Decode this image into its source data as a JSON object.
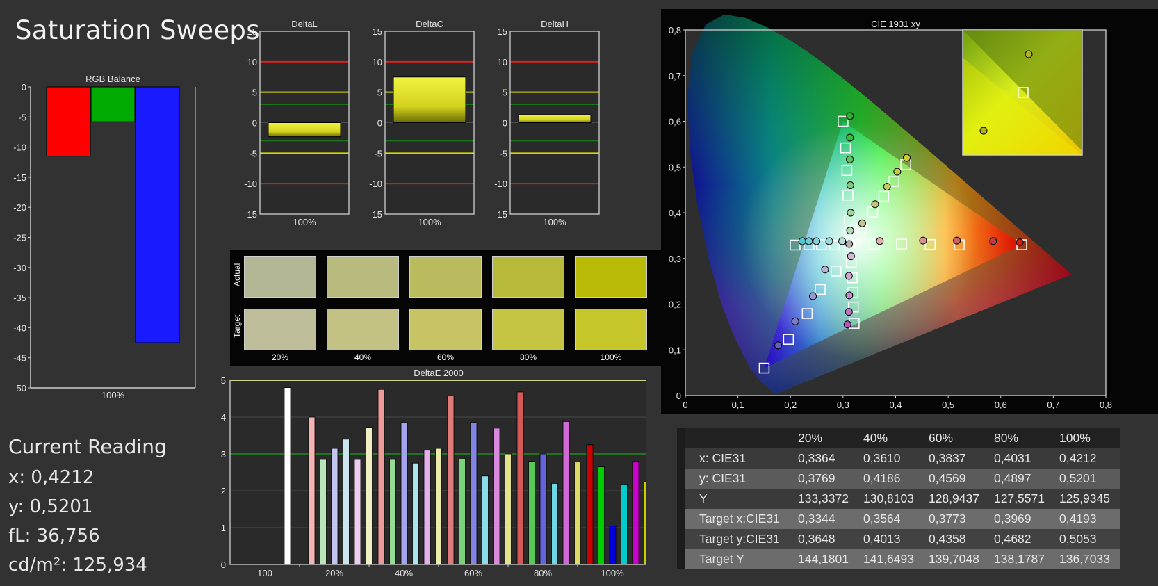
{
  "page": {
    "title": "Saturation Sweeps"
  },
  "current_reading": {
    "heading": "Current Reading",
    "x": "x: 0,4212",
    "y": "y: 0,5201",
    "fl": "fL: 36,756",
    "cdm2": "cd/m²: 125,934"
  },
  "swatches": {
    "row_labels": [
      "Actual",
      "Target"
    ],
    "columns": [
      "20%",
      "40%",
      "60%",
      "80%",
      "100%"
    ],
    "actual_colors": [
      "#b3b794",
      "#b8ba7e",
      "#b9bb5e",
      "#b6b93a",
      "#b9ba05"
    ],
    "target_colors": [
      "#bfbe9b",
      "#c3c183",
      "#c6c464",
      "#c5c443",
      "#c6c529"
    ]
  },
  "table": {
    "headers": [
      "",
      "20%",
      "40%",
      "60%",
      "80%",
      "100%"
    ],
    "rows": [
      {
        "label": "x: CIE31",
        "values": [
          "0,3364",
          "0,3610",
          "0,3837",
          "0,4031",
          "0,4212"
        ]
      },
      {
        "label": "y: CIE31",
        "values": [
          "0,3769",
          "0,4186",
          "0,4569",
          "0,4897",
          "0,5201"
        ]
      },
      {
        "label": "Y",
        "values": [
          "133,3372",
          "130,8103",
          "128,9437",
          "127,5571",
          "125,9345"
        ]
      },
      {
        "label": "Target x:CIE31",
        "values": [
          "0,3344",
          "0,3564",
          "0,3773",
          "0,3969",
          "0,4193"
        ]
      },
      {
        "label": "Target y:CIE31",
        "values": [
          "0,3648",
          "0,4013",
          "0,4358",
          "0,4682",
          "0,5053"
        ]
      },
      {
        "label": "Target Y",
        "values": [
          "144,1801",
          "141,6493",
          "139,7048",
          "138,1787",
          "136,7033"
        ]
      }
    ]
  },
  "chart_data": [
    {
      "id": "rgb",
      "type": "bar",
      "title": "RGB Balance",
      "categories": [
        "100%"
      ],
      "series": [
        {
          "values": [
            -11.5
          ],
          "color": "#ff0000"
        },
        {
          "values": [
            -5.8
          ],
          "color": "#00aa00"
        },
        {
          "values": [
            -42.5
          ],
          "color": "#1a1aff"
        }
      ],
      "yticks": [
        0,
        -5,
        -10,
        -15,
        -20,
        -25,
        -30,
        -35,
        -40,
        -45,
        -50
      ],
      "ylim": [
        -50,
        0
      ],
      "grid": true
    },
    {
      "id": "deltaL",
      "type": "bar",
      "title": "DeltaL",
      "categories": [
        "100%"
      ],
      "values": [
        -2.3
      ],
      "yticks": [
        15,
        10,
        5,
        0,
        -5,
        -10,
        -15
      ],
      "ylim": [
        -15,
        15
      ],
      "reference_lines": {
        "red": [
          10,
          -10
        ],
        "yellow": [
          5,
          -5
        ],
        "green": [
          3,
          -3
        ]
      }
    },
    {
      "id": "deltaC",
      "type": "bar",
      "title": "DeltaC",
      "categories": [
        "100%"
      ],
      "values": [
        7.5
      ],
      "yticks": [
        15,
        10,
        5,
        0,
        -5,
        -10,
        -15
      ],
      "ylim": [
        -15,
        15
      ],
      "reference_lines": {
        "red": [
          10,
          -10
        ],
        "yellow": [
          5,
          -5
        ],
        "green": [
          3,
          -3
        ]
      }
    },
    {
      "id": "deltaH",
      "type": "bar",
      "title": "DeltaH",
      "categories": [
        "100%"
      ],
      "values": [
        1.3
      ],
      "yticks": [
        15,
        10,
        5,
        0,
        -5,
        -10,
        -15
      ],
      "ylim": [
        -15,
        15
      ],
      "reference_lines": {
        "red": [
          10,
          -10
        ],
        "yellow": [
          5,
          -5
        ],
        "green": [
          3,
          -3
        ]
      }
    },
    {
      "id": "deltaE",
      "type": "bar",
      "title": "DeltaE 2000",
      "categories": [
        "100",
        "20%",
        "40%",
        "60%",
        "80%",
        "100%"
      ],
      "groups": [
        [
          {
            "v": 4.8,
            "c": "#ffffff"
          }
        ],
        [
          {
            "v": 4.0,
            "c": "#f4b4b4"
          },
          {
            "v": 2.85,
            "c": "#b8e6b8"
          },
          {
            "v": 3.15,
            "c": "#c4c4f0"
          },
          {
            "v": 3.4,
            "c": "#cce6ee"
          },
          {
            "v": 2.85,
            "c": "#eccfee"
          },
          {
            "v": 3.72,
            "c": "#f0f0c4"
          }
        ],
        [
          {
            "v": 4.75,
            "c": "#ec9a9a"
          },
          {
            "v": 2.85,
            "c": "#96dc96"
          },
          {
            "v": 3.85,
            "c": "#a4a4ec"
          },
          {
            "v": 2.75,
            "c": "#b0e4ec"
          },
          {
            "v": 3.1,
            "c": "#e4b0e8"
          },
          {
            "v": 3.15,
            "c": "#ececaa"
          }
        ],
        [
          {
            "v": 4.58,
            "c": "#e07a7a"
          },
          {
            "v": 2.88,
            "c": "#7ad27a"
          },
          {
            "v": 3.85,
            "c": "#8484e4"
          },
          {
            "v": 2.4,
            "c": "#8cdcec"
          },
          {
            "v": 3.7,
            "c": "#da8ade"
          },
          {
            "v": 3.0,
            "c": "#e4e48c"
          }
        ],
        [
          {
            "v": 4.68,
            "c": "#d45858"
          },
          {
            "v": 2.8,
            "c": "#58c858"
          },
          {
            "v": 3.0,
            "c": "#6464dc"
          },
          {
            "v": 2.2,
            "c": "#6cd8e8"
          },
          {
            "v": 3.88,
            "c": "#d068d6"
          },
          {
            "v": 2.78,
            "c": "#dcdc64"
          }
        ],
        [
          {
            "v": 3.25,
            "c": "#cc0000"
          },
          {
            "v": 2.65,
            "c": "#00cc00"
          },
          {
            "v": 1.05,
            "c": "#0000dd"
          },
          {
            "v": 2.18,
            "c": "#00cccc"
          },
          {
            "v": 2.8,
            "c": "#cc00cc"
          },
          {
            "v": 2.25,
            "c": "#cccc00"
          }
        ]
      ],
      "yticks": [
        0,
        1,
        2,
        3,
        4,
        5
      ],
      "ylim": [
        0,
        5
      ],
      "reference_lines": {
        "green": [
          3
        ],
        "yellow": [
          5
        ]
      }
    },
    {
      "id": "cie",
      "type": "scatter",
      "title": "CIE 1931 xy",
      "xlim": [
        0,
        0.8
      ],
      "ylim": [
        0,
        0.8
      ],
      "xticks": [
        "0",
        "0,1",
        "0,2",
        "0,3",
        "0,4",
        "0,5",
        "0,6",
        "0,7",
        "0,8"
      ],
      "yticks": [
        "0,1",
        "0,2",
        "0,3",
        "0,4",
        "0,5",
        "0,6",
        "0,7",
        "0,8"
      ],
      "gamut": [
        [
          0.64,
          0.33
        ],
        [
          0.3,
          0.6
        ],
        [
          0.15,
          0.06
        ]
      ],
      "white": [
        0.3127,
        0.329
      ],
      "target_points": [
        [
          0.3127,
          0.329
        ],
        [
          0.3596,
          0.3311
        ],
        [
          0.4114,
          0.3312
        ],
        [
          0.4658,
          0.3305
        ],
        [
          0.5211,
          0.3299
        ],
        [
          0.64,
          0.33
        ],
        [
          0.3122,
          0.3575
        ],
        [
          0.3116,
          0.3832
        ],
        [
          0.3093,
          0.4382
        ],
        [
          0.3074,
          0.4924
        ],
        [
          0.3048,
          0.542
        ],
        [
          0.3,
          0.6
        ],
        [
          0.2866,
          0.2724
        ],
        [
          0.2565,
          0.2321
        ],
        [
          0.2319,
          0.1794
        ],
        [
          0.1962,
          0.1229
        ],
        [
          0.15,
          0.06
        ],
        [
          0.2838,
          0.3299
        ],
        [
          0.2589,
          0.3303
        ],
        [
          0.2353,
          0.3299
        ],
        [
          0.2089,
          0.3293
        ],
        [
          0.3156,
          0.2914
        ],
        [
          0.3174,
          0.2575
        ],
        [
          0.3185,
          0.225
        ],
        [
          0.3196,
          0.1935
        ],
        [
          0.3212,
          0.1579
        ],
        [
          0.3344,
          0.3648
        ],
        [
          0.3564,
          0.4013
        ],
        [
          0.3773,
          0.4358
        ],
        [
          0.3969,
          0.4682
        ],
        [
          0.4193,
          0.5053
        ]
      ],
      "measured_points": [
        {
          "xy": [
            0.3115,
            0.3315
          ],
          "c": "#b0b0b0"
        },
        {
          "xy": [
            0.37,
            0.338
          ],
          "c": "#dfb0b0"
        },
        {
          "xy": [
            0.4522,
            0.339
          ],
          "c": "#d89090"
        },
        {
          "xy": [
            0.5165,
            0.339
          ],
          "c": "#c86464"
        },
        {
          "xy": [
            0.5856,
            0.338
          ],
          "c": "#c03c3c"
        },
        {
          "xy": [
            0.6362,
            0.3351
          ],
          "c": "#cc2020"
        },
        {
          "xy": [
            0.3135,
            0.361
          ],
          "c": "#b8d8b8"
        },
        {
          "xy": [
            0.3145,
            0.4
          ],
          "c": "#a0d4a0"
        },
        {
          "xy": [
            0.3138,
            0.4601
          ],
          "c": "#80c880"
        },
        {
          "xy": [
            0.3129,
            0.5167
          ],
          "c": "#60c060"
        },
        {
          "xy": [
            0.3132,
            0.5643
          ],
          "c": "#40b840"
        },
        {
          "xy": [
            0.3131,
            0.6115
          ],
          "c": "#30b030"
        },
        {
          "xy": [
            0.2658,
            0.2756
          ],
          "c": "#b4b4d4"
        },
        {
          "xy": [
            0.2427,
            0.2175
          ],
          "c": "#9a9ad0"
        },
        {
          "xy": [
            0.2091,
            0.1624
          ],
          "c": "#7c7cc4"
        },
        {
          "xy": [
            0.1765,
            0.1098
          ],
          "c": "#6060c0"
        },
        {
          "xy": [
            0.2983,
            0.3377
          ],
          "c": "#b8dcdc"
        },
        {
          "xy": [
            0.2738,
            0.3377
          ],
          "c": "#a0d8dc"
        },
        {
          "xy": [
            0.2494,
            0.3377
          ],
          "c": "#88d0d8"
        },
        {
          "xy": [
            0.2352,
            0.3377
          ],
          "c": "#70ccd4"
        },
        {
          "xy": [
            0.2224,
            0.3377
          ],
          "c": "#50c8d0"
        },
        {
          "xy": [
            0.3152,
            0.3047
          ],
          "c": "#d8b8d8"
        },
        {
          "xy": [
            0.3111,
            0.2617
          ],
          "c": "#d4a4d4"
        },
        {
          "xy": [
            0.3119,
            0.2192
          ],
          "c": "#cc88cc"
        },
        {
          "xy": [
            0.3111,
            0.1831
          ],
          "c": "#c470c4"
        },
        {
          "xy": [
            0.3085,
            0.1556
          ],
          "c": "#bc50bc"
        },
        {
          "xy": [
            0.3364,
            0.3769
          ],
          "c": "#c4c490"
        },
        {
          "xy": [
            0.361,
            0.4186
          ],
          "c": "#c4c478"
        },
        {
          "xy": [
            0.3837,
            0.4569
          ],
          "c": "#c8c860"
        },
        {
          "xy": [
            0.4031,
            0.4897
          ],
          "c": "#c8c848"
        },
        {
          "xy": [
            0.4212,
            0.5201
          ],
          "c": "#cccc30"
        }
      ]
    }
  ]
}
